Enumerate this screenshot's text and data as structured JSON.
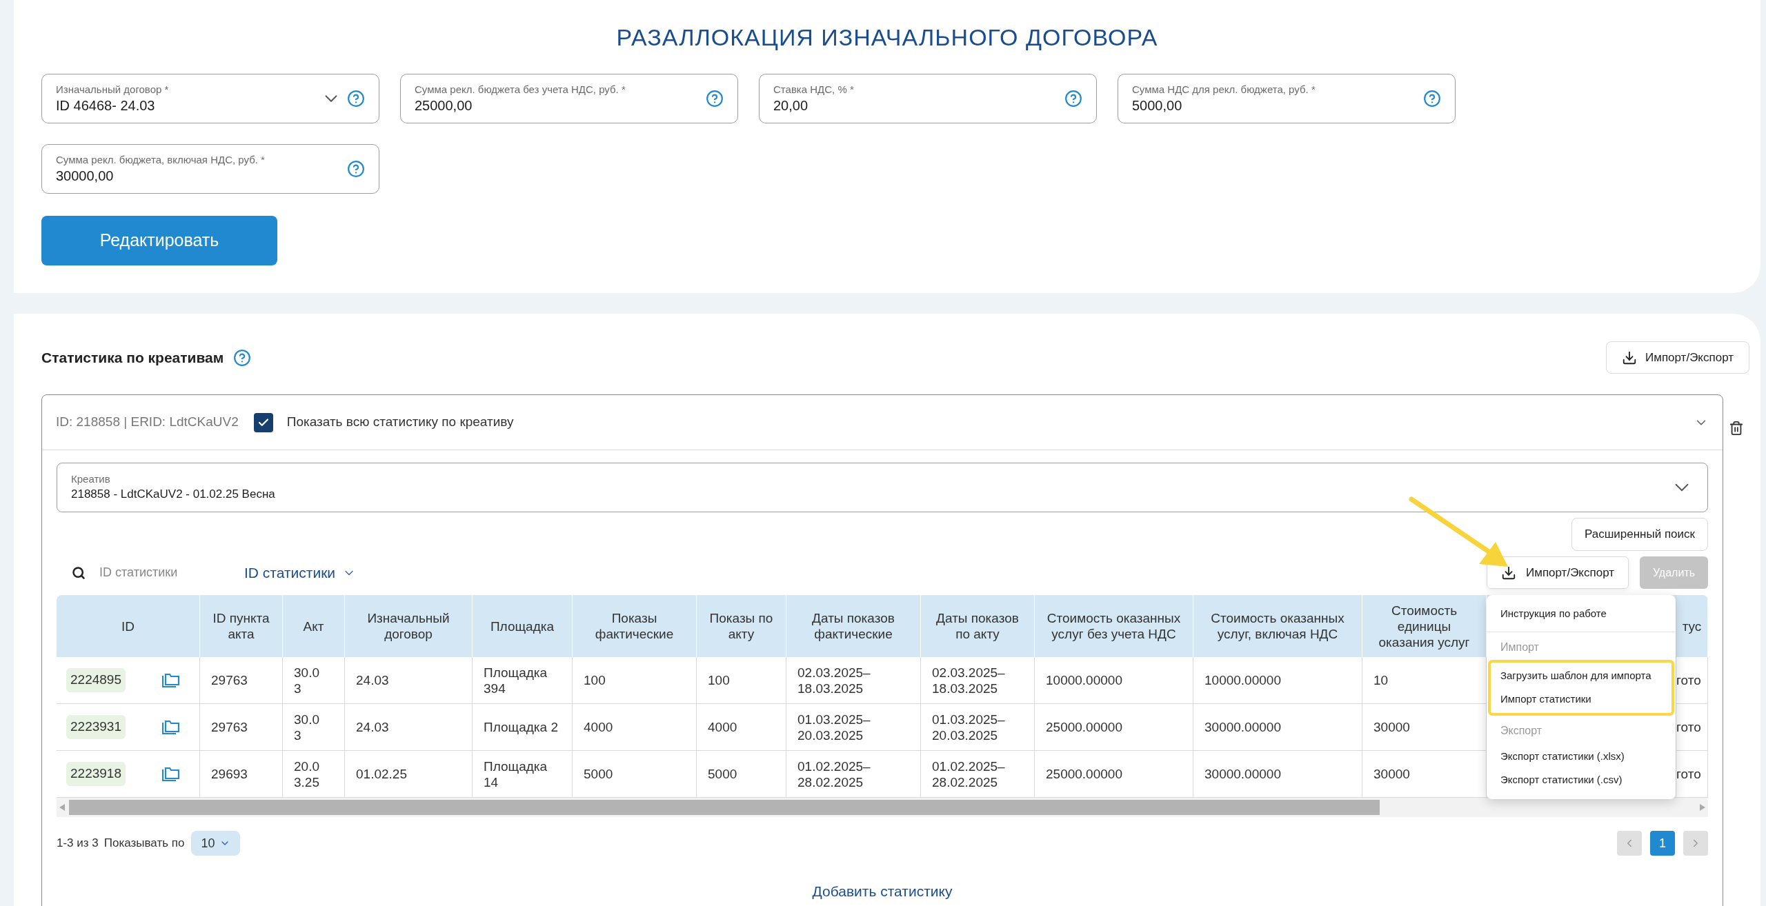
{
  "title": "РАЗАЛЛОКАЦИЯ ИЗНАЧАЛЬНОГО ДОГОВОРА",
  "fields": [
    {
      "kind": "select",
      "label": "Изначальный договор *",
      "value": "ID 46468- 24.03"
    },
    {
      "kind": "text",
      "label": "Сумма рекл. бюджета без учета НДС, руб. *",
      "value": "25000,00"
    },
    {
      "kind": "text",
      "label": "Ставка НДС, % *",
      "value": "20,00"
    },
    {
      "kind": "text",
      "label": "Сумма НДС для рекл. бюджета, руб. *",
      "value": "5000,00"
    },
    {
      "kind": "text",
      "label": "Сумма рекл. бюджета, включая НДС, руб. *",
      "value": "30000,00"
    }
  ],
  "edit_button": "Редактировать",
  "section": {
    "title": "Статистика по креативам",
    "import_export_button": "Импорт/Экспорт"
  },
  "creative_panel": {
    "header": "ID: 218858 | ERID: LdtCKaUV2",
    "show_all": {
      "label": "Показать всю статистику по креативу",
      "checked": true
    },
    "creative_field": {
      "label": "Креатив",
      "value": "218858 - LdtCKaUV2 - 01.02.25 Весна"
    },
    "advanced_search": "Расширенный поиск",
    "search": {
      "placeholder": "ID статистики"
    },
    "search_by": "ID статистики",
    "import_export_button": "Импорт/Экспорт",
    "delete_button": {
      "label": "Удалить",
      "disabled": true
    },
    "table": {
      "columns": [
        "ID",
        "ID пункта акта",
        "Акт",
        "Изначальный договор",
        "Площадка",
        "Показы фактические",
        "Показы по акту",
        "Даты показов фактические",
        "Даты показов по акту",
        "Стоимость оказанных услуг без учета НДС",
        "Стоимость оказанных услуг, включая НДС",
        "Стоимость единицы оказания услуг",
        "тус"
      ],
      "rows": [
        [
          "2224895",
          "29763",
          "30.03",
          "24.03",
          "Площадка 394",
          "100",
          "100",
          "02.03.2025–18.03.2025",
          "02.03.2025–18.03.2025",
          "10000.00000",
          "10000.00000",
          "10",
          "гото"
        ],
        [
          "2223931",
          "29763",
          "30.03",
          "24.03",
          "Площадка 2",
          "4000",
          "4000",
          "01.03.2025–20.03.2025",
          "01.03.2025–20.03.2025",
          "25000.00000",
          "30000.00000",
          "30000",
          "гото"
        ],
        [
          "2223918",
          "29693",
          "20.03.25",
          "01.02.25",
          "Площадка 14",
          "5000",
          "5000",
          "01.02.2025–28.02.2025",
          "01.02.2025–28.02.2025",
          "25000.00000",
          "30000.00000",
          "30000",
          "гото"
        ]
      ]
    },
    "menu": {
      "sections": [
        {
          "items": [
            "Инструкция по работе"
          ],
          "highlighted": false
        },
        {
          "heading": "Импорт",
          "items": [
            "Загрузить шаблон для импорта",
            "Импорт статистики"
          ],
          "highlighted": true
        },
        {
          "heading": "Экспорт",
          "items": [
            "Экспорт статистики (.xlsx)",
            "Экспорт статистики (.csv)"
          ],
          "highlighted": false
        }
      ]
    },
    "pagination": {
      "range": "1-3 из 3",
      "per_page_label": "Показывать по",
      "per_page": "10",
      "pages": [
        {
          "label": "1",
          "selected": true
        }
      ]
    },
    "add_link": "Добавить статистику"
  }
}
